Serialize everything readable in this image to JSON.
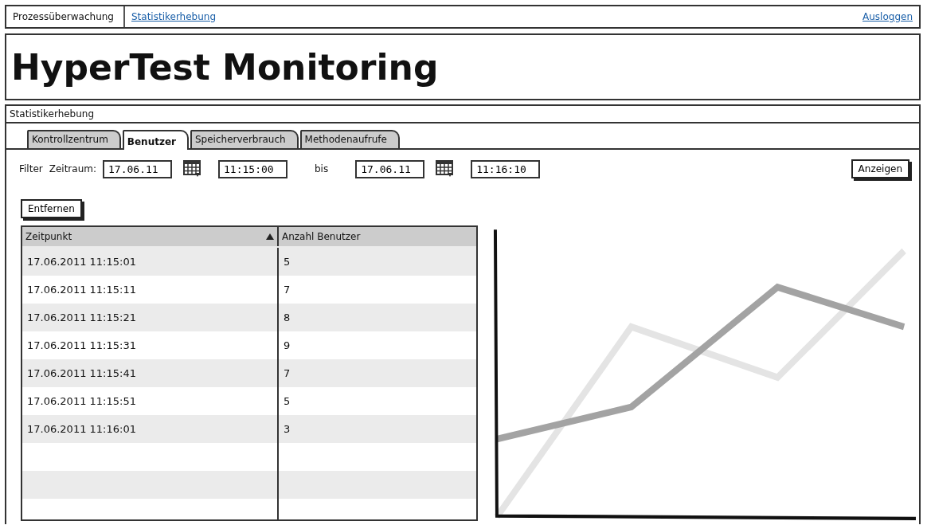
{
  "nav": {
    "items": [
      {
        "label": "Prozessüberwachung",
        "kind": "text"
      },
      {
        "label": "Statistikerhebung",
        "kind": "link"
      }
    ],
    "logout": "Ausloggen"
  },
  "header": {
    "title": "HyperTest Monitoring"
  },
  "panel": {
    "title": "Statistikerhebung",
    "tabs": [
      {
        "label": "Kontrollzentrum",
        "selected": false
      },
      {
        "label": "Benutzer",
        "selected": true
      },
      {
        "label": "Speicherverbrauch",
        "selected": false
      },
      {
        "label": "Methodenaufrufe",
        "selected": false
      }
    ],
    "filter": {
      "label": "Filter",
      "period_label": "Zeitraum:",
      "from_date": "17.06.11",
      "from_time": "11:15:00",
      "to_label": "bis",
      "to_date": "17.06.11",
      "to_time": "11:16:10",
      "button": "Anzeigen"
    },
    "remove_button": "Entfernen",
    "table": {
      "columns": [
        {
          "label": "Zeitpunkt",
          "sorted_ascending": true
        },
        {
          "label": "Anzahl Benutzer"
        }
      ],
      "rows": [
        [
          "17.06.2011 11:15:01",
          "5"
        ],
        [
          "17.06.2011 11:15:11",
          "7"
        ],
        [
          "17.06.2011 11:15:21",
          "8"
        ],
        [
          "17.06.2011 11:15:31",
          "9"
        ],
        [
          "17.06.2011 11:15:41",
          "7"
        ],
        [
          "17.06.2011 11:15:51",
          "5"
        ],
        [
          "17.06.2011 11:16:01",
          "3"
        ]
      ]
    }
  }
}
